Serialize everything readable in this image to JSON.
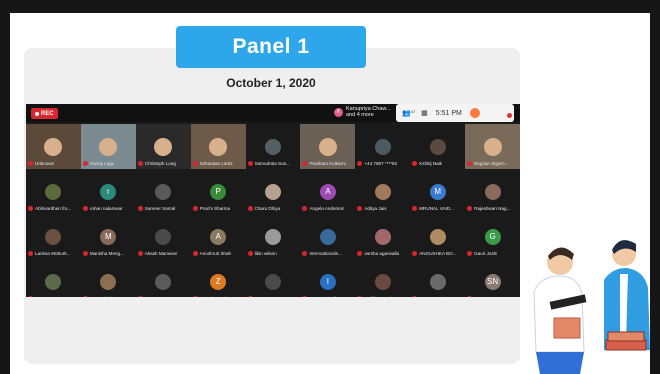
{
  "banner": {
    "title": "Panel 1"
  },
  "date": "October 1, 2020",
  "zoom": {
    "rec_label": "REC",
    "notification": {
      "avatar_letter": "K",
      "line1": "Kanupriya Chaw...",
      "line2": "and 4 more"
    },
    "participants_icon": "participants-icon",
    "participant_count": "47",
    "time": "5:51 PM",
    "colors": {
      "rec": "#d8262e",
      "mic_muted": "#d8262e",
      "banner": "#2ea7ea"
    }
  },
  "participants": [
    [
      {
        "name": "Unknown",
        "type": "video",
        "color": "#5b4a3a"
      },
      {
        "name": "Sunny Lagu",
        "type": "video",
        "color": "#7a8a90"
      },
      {
        "name": "Christoph Lueg",
        "type": "video",
        "color": "#2a2a2a"
      },
      {
        "name": "Sebastian Lantz",
        "type": "video",
        "color": "#6e5a48"
      },
      {
        "name": "Samudrala Sus...",
        "type": "photo",
        "color": "#556066"
      },
      {
        "name": "Prashant Kulkarni",
        "type": "video",
        "color": "#6a6055"
      },
      {
        "name": "+44 7887 ****82",
        "type": "photo",
        "color": "#4c5a64"
      },
      {
        "name": "Kshitij Naik",
        "type": "photo",
        "color": "#5a4a40"
      },
      {
        "name": "Bogdan Sigorn...",
        "type": "video",
        "color": "#7a6a5a"
      }
    ],
    [
      {
        "name": "Abhivardhan fro...",
        "type": "photo",
        "color": "#5a6a3a"
      },
      {
        "name": "rohan nalamwar",
        "type": "letter",
        "letter": "r",
        "color": "#2a8a7a"
      },
      {
        "name": "Sameer Samal",
        "type": "photo",
        "color": "#5a5a5a"
      },
      {
        "name": "Prachi Sharma",
        "type": "letter",
        "letter": "P",
        "color": "#3a8a3a"
      },
      {
        "name": "Charu Dhiya",
        "type": "photo",
        "color": "#b8a090"
      },
      {
        "name": "Angela Anderson",
        "type": "letter",
        "letter": "A",
        "color": "#9a4ab0"
      },
      {
        "name": "Aditya Jais",
        "type": "photo",
        "color": "#a07a5a"
      },
      {
        "name": "MRUNAL VAID...",
        "type": "letter",
        "letter": "M",
        "color": "#3a7ad0"
      },
      {
        "name": "Rajeshwari Nag...",
        "type": "photo",
        "color": "#8a6a5a"
      }
    ],
    [
      {
        "name": "Larissa McBurk...",
        "type": "photo",
        "color": "#6a5040"
      },
      {
        "name": "Manisha Meng...",
        "type": "letter",
        "letter": "M",
        "color": "#8a6a5a"
      },
      {
        "name": "Akash Manwani",
        "type": "photo",
        "color": "#4a4a4a"
      },
      {
        "name": "Anushruti Shah",
        "type": "letter",
        "letter": "A",
        "color": "#8a7a60"
      },
      {
        "name": "libin wilson",
        "type": "photo",
        "color": "#9a9a9a"
      },
      {
        "name": "Internationalis...",
        "type": "photo",
        "color": "#3a6a9a"
      },
      {
        "name": "varsha agarwalla",
        "type": "photo",
        "color": "#a06a6a"
      },
      {
        "name": "ANOUSHKA BO...",
        "type": "photo",
        "color": "#b08a60"
      },
      {
        "name": "Gauri Joshi",
        "type": "letter",
        "letter": "G",
        "color": "#3a9a4a"
      }
    ],
    [
      {
        "name": "PRANAY GOLC...",
        "type": "photo",
        "color": "#5a6a4a"
      },
      {
        "name": "sampada kapse",
        "type": "photo",
        "color": "#8a7050"
      },
      {
        "name": "SHUBHANKAR ...",
        "type": "photo",
        "color": "#5a5a5a"
      },
      {
        "name": "Zainab Vanak",
        "type": "letter",
        "letter": "Z",
        "color": "#e07a20"
      },
      {
        "name": "SHUBHANKAR ...",
        "type": "photo",
        "color": "#4a4a4a"
      },
      {
        "name": "Internationalis...",
        "type": "letter",
        "letter": "I",
        "color": "#2a70c0"
      },
      {
        "name": "mallika tewari",
        "type": "photo",
        "color": "#6a4a40"
      },
      {
        "name": "Jesse Jacob V",
        "type": "photo",
        "color": "#6a6a6a"
      },
      {
        "name": "SN",
        "type": "letter",
        "letter": "SN",
        "color": "#8a7a70"
      }
    ]
  ]
}
